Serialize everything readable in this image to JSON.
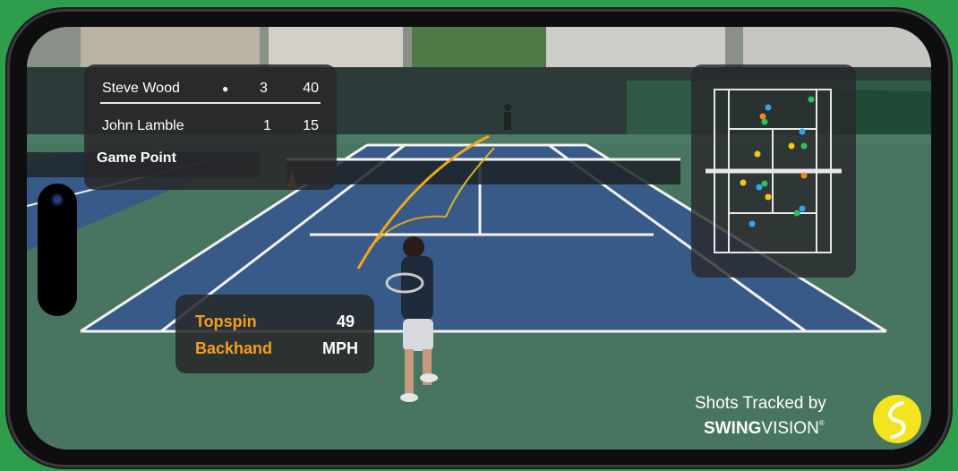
{
  "scoreboard": {
    "player1": {
      "name": "Steve Wood",
      "serve_marker": "●",
      "games": "3",
      "points": "40"
    },
    "player2": {
      "name": "John Lamble",
      "games": "1",
      "points": "15"
    },
    "status": "Game Point"
  },
  "shot_info": {
    "spin": "Topspin",
    "stroke": "Backhand",
    "speed": "49",
    "unit": "MPH"
  },
  "branding": {
    "line1": "Shots Tracked by",
    "brand_bold": "SWING",
    "brand_light": "VISION",
    "registered_mark": "®"
  },
  "minimap": {
    "dot_colors": {
      "blue": "#2aa7f0",
      "yellow": "#f5c518",
      "orange": "#f08a18",
      "green": "#2fbf5a"
    }
  },
  "colors": {
    "accent_orange": "#f3a018",
    "court_blue": "#3a5a8a",
    "background_green": "#2f9e4c"
  }
}
